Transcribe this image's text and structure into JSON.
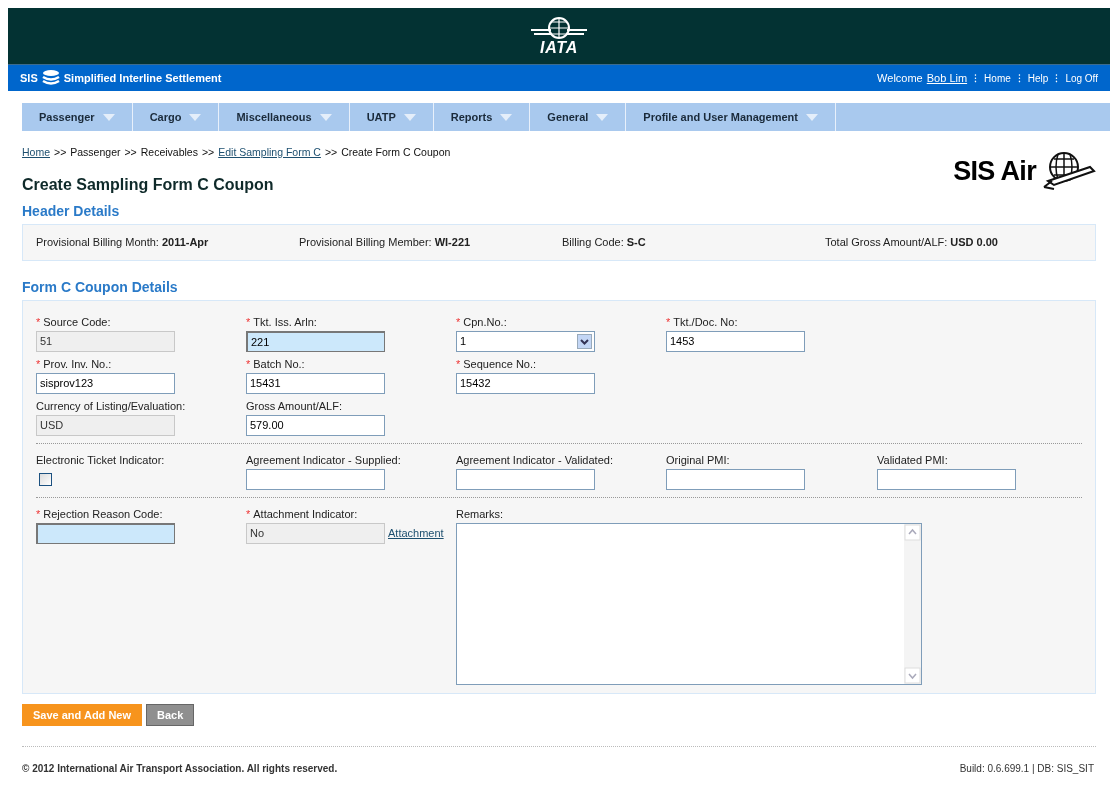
{
  "banner": {
    "logo": "IATA"
  },
  "topbar": {
    "brand": "SIS",
    "app_name": "Simplified Interline Settlement",
    "welcome": "Welcome",
    "user": "Bob Lim",
    "links": [
      "Home",
      "Help",
      "Log Off"
    ],
    "separator": "⁝"
  },
  "menu": [
    {
      "label": "Passenger"
    },
    {
      "label": "Cargo"
    },
    {
      "label": "Miscellaneous"
    },
    {
      "label": "UATP"
    },
    {
      "label": "Reports"
    },
    {
      "label": "General"
    },
    {
      "label": "Profile and User Management"
    }
  ],
  "breadcrumb": {
    "separator": ">>",
    "items": [
      {
        "label": "Home",
        "link": true
      },
      {
        "label": "Passenger",
        "link": false
      },
      {
        "label": "Receivables",
        "link": false
      },
      {
        "label": "Edit Sampling Form C",
        "link": true
      },
      {
        "label": "Create Form C Coupon",
        "link": false
      }
    ]
  },
  "page_title": "Create Sampling Form C Coupon",
  "product_logo": "SIS Air",
  "header_details": {
    "title": "Header Details",
    "fields": [
      {
        "label": "Provisional Billing Month:",
        "value": "2011-Apr"
      },
      {
        "label": "Provisional Billing Member:",
        "value": "WI-221"
      },
      {
        "label": "Billing Code:",
        "value": "S-C"
      },
      {
        "label": "Total Gross Amount/ALF:",
        "value": "USD 0.00"
      }
    ]
  },
  "coupon_details": {
    "title": "Form C Coupon Details",
    "required_mark": "*",
    "sections": [
      {
        "rows": [
          [
            {
              "kind": "text",
              "label": "Source Code:",
              "required": true,
              "value": "51",
              "disabled": true,
              "highlighted": false
            },
            {
              "kind": "text",
              "label": "Tkt. Iss. Arln:",
              "required": true,
              "value": "221",
              "disabled": false,
              "highlighted": true
            },
            {
              "kind": "select",
              "label": "Cpn.No.:",
              "required": true,
              "value": "1"
            },
            {
              "kind": "text",
              "label": "Tkt./Doc. No:",
              "required": true,
              "value": "1453",
              "disabled": false,
              "highlighted": false
            }
          ],
          [
            {
              "kind": "text",
              "label": "Prov. Inv. No.:",
              "required": true,
              "value": "sisprov123",
              "disabled": false,
              "highlighted": false
            },
            {
              "kind": "text",
              "label": "Batch No.:",
              "required": true,
              "value": "15431",
              "disabled": false,
              "highlighted": false
            },
            {
              "kind": "text",
              "label": "Sequence No.:",
              "required": true,
              "value": "15432",
              "disabled": false,
              "highlighted": false
            }
          ],
          [
            {
              "kind": "text",
              "label": "Currency of Listing/Evaluation:",
              "required": false,
              "value": "USD",
              "disabled": true,
              "highlighted": false
            },
            {
              "kind": "text",
              "label": "Gross Amount/ALF:",
              "required": false,
              "value": "579.00",
              "disabled": false,
              "highlighted": false
            }
          ]
        ]
      },
      {
        "rows": [
          [
            {
              "kind": "checkbox",
              "label": "Electronic Ticket Indicator:",
              "required": false,
              "checked": false
            },
            {
              "kind": "text",
              "label": "Agreement Indicator - Supplied:",
              "required": false,
              "disabled": false,
              "highlighted": false
            },
            {
              "kind": "text",
              "label": "Agreement Indicator - Validated:",
              "required": false,
              "disabled": false,
              "highlighted": false
            },
            {
              "kind": "text",
              "label": "Original PMI:",
              "required": false,
              "disabled": false,
              "highlighted": false
            },
            {
              "kind": "text",
              "label": "Validated PMI:",
              "required": false,
              "disabled": false,
              "highlighted": false
            }
          ]
        ]
      },
      {
        "rows": [
          [
            {
              "kind": "text",
              "label": "Rejection Reason Code:",
              "required": true,
              "disabled": false,
              "highlighted": true
            },
            {
              "kind": "text",
              "label": "Attachment Indicator:",
              "required": true,
              "value": "No",
              "disabled": true,
              "highlighted": false,
              "link": "Attachment"
            },
            {
              "kind": "textarea",
              "label": "Remarks:",
              "required": false
            }
          ]
        ]
      }
    ]
  },
  "buttons": [
    {
      "label": "Save and Add New",
      "kind": "primary"
    },
    {
      "label": "Back",
      "kind": "secondary"
    }
  ],
  "footer": {
    "copyright": "© 2012 International Air Transport Association. All rights reserved.",
    "build": "Build: 0.6.699.1 | DB: SIS_SIT"
  }
}
